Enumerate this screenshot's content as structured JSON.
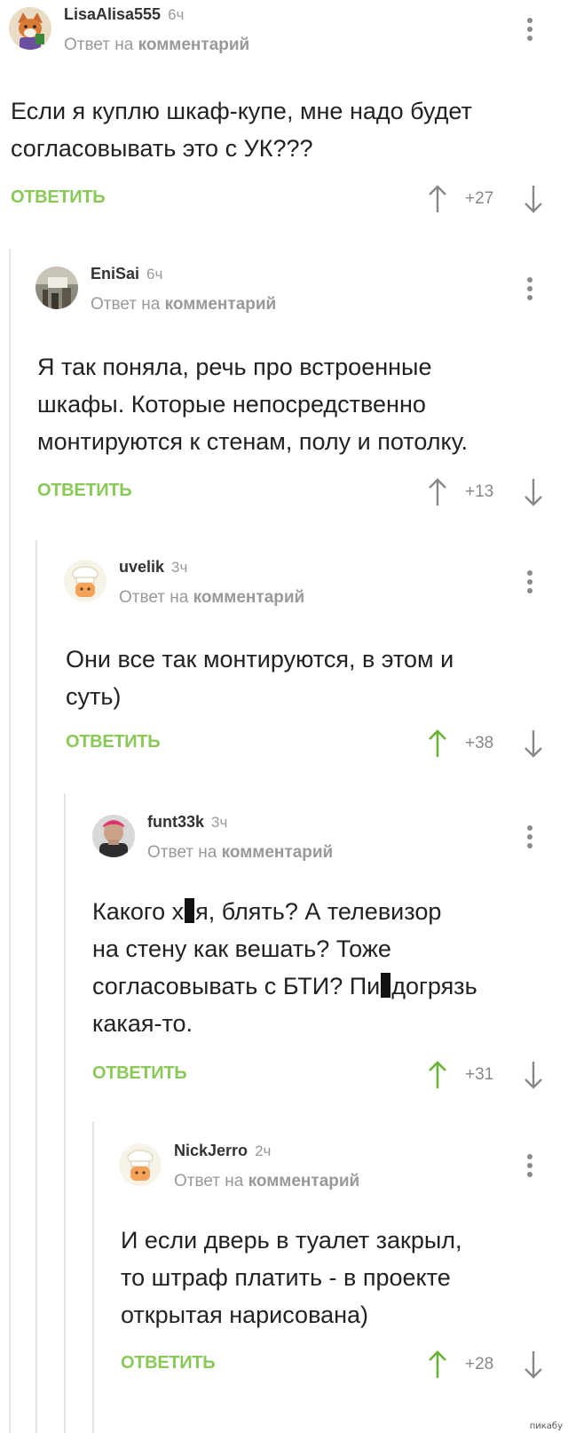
{
  "colors": {
    "accent_green": "#8ac858",
    "upvoted_green": "#6ab23a",
    "muted": "#999999"
  },
  "common": {
    "reply_label": "ОТВЕТИТЬ",
    "reply_to_prefix": "Ответ на",
    "reply_to_link": "комментарий"
  },
  "comments": [
    {
      "author": "LisaAlisa555",
      "time": "6ч",
      "avatar": "fox-avatar",
      "lines": [
        "Если я куплю шкаф-купе, мне надо будет",
        "согласовывать это с УК???"
      ],
      "rating": "+27",
      "upvoted": false
    },
    {
      "author": "EniSai",
      "time": "6ч",
      "avatar": "photo-avatar",
      "lines": [
        "Я так поняла, речь про встроенные",
        "шкафы. Которые непосредственно",
        "монтируются к стенам, полу и потолку."
      ],
      "rating": "+13",
      "upvoted": false
    },
    {
      "author": "uvelik",
      "time": "3ч",
      "avatar": "default-chef-avatar",
      "lines": [
        "Они все так монтируются, в этом и",
        "суть)"
      ],
      "rating": "+38",
      "upvoted": true
    },
    {
      "author": "funt33k",
      "time": "3ч",
      "avatar": "photo-avatar",
      "lines": [
        "Какого х",
        "я, блять? А телевизор",
        "на стену как вешать? Тоже",
        "согласовывать с БТИ? Пи",
        "догрязь",
        "какая-то."
      ],
      "rating": "+31",
      "upvoted": true
    },
    {
      "author": "NickJerro",
      "time": "2ч",
      "avatar": "default-chef-avatar",
      "lines": [
        "И если дверь в туалет закрыл,",
        "то штраф платить - в проекте",
        "открытая нарисована)"
      ],
      "rating": "+28",
      "upvoted": true
    }
  ],
  "watermark": "пикабу"
}
